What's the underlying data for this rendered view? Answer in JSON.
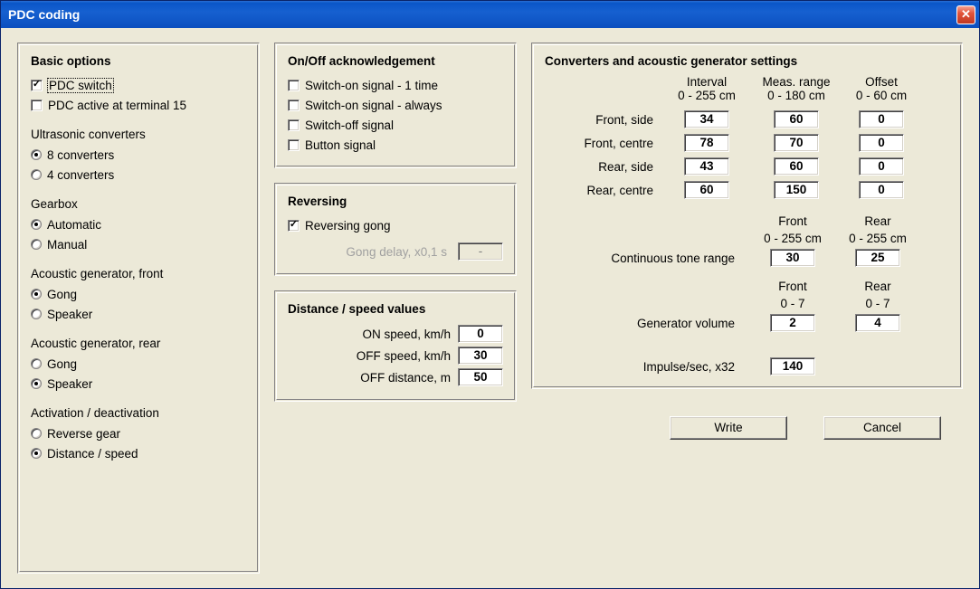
{
  "window": {
    "title": "PDC coding"
  },
  "basic": {
    "title": "Basic options",
    "pdc_switch_label": "PDC switch",
    "pdc_switch": true,
    "pdc_terminal15_label": "PDC active at terminal 15",
    "pdc_terminal15": false,
    "ultrasonic_label": "Ultrasonic converters",
    "ultrasonic_options": {
      "eight": "8 converters",
      "four": "4 converters"
    },
    "ultrasonic_selected": "eight",
    "gearbox_label": "Gearbox",
    "gearbox_options": {
      "auto": "Automatic",
      "manual": "Manual"
    },
    "gearbox_selected": "auto",
    "acoustic_front_label": "Acoustic generator, front",
    "acoustic_options": {
      "gong": "Gong",
      "speaker": "Speaker"
    },
    "acoustic_front_selected": "gong",
    "acoustic_rear_label": "Acoustic generator, rear",
    "acoustic_rear_selected": "speaker",
    "activation_label": "Activation / deactivation",
    "activation_options": {
      "reverse": "Reverse gear",
      "distance": "Distance / speed"
    },
    "activation_selected": "distance"
  },
  "onoff": {
    "title": "On/Off acknowledgement",
    "items": {
      "on1": {
        "label": "Switch-on signal - 1 time",
        "checked": false
      },
      "onalways": {
        "label": "Switch-on signal - always",
        "checked": false
      },
      "off": {
        "label": "Switch-off signal",
        "checked": false
      },
      "button": {
        "label": "Button signal",
        "checked": false
      }
    }
  },
  "reversing": {
    "title": "Reversing",
    "gong_label": "Reversing gong",
    "gong_checked": true,
    "delay_label": "Gong delay, x0,1 s",
    "delay_value": "-"
  },
  "distspeed": {
    "title": "Distance / speed values",
    "on_speed_label": "ON speed, km/h",
    "on_speed": "0",
    "off_speed_label": "OFF speed, km/h",
    "off_speed": "30",
    "off_dist_label": "OFF distance, m",
    "off_dist": "50"
  },
  "conv": {
    "title": "Converters and acoustic generator settings",
    "headers": {
      "interval": "Interval",
      "interval_range": "0 - 255 cm",
      "meas": "Meas. range",
      "meas_range": "0 - 180 cm",
      "offset": "Offset",
      "offset_range": "0 - 60 cm"
    },
    "rows": {
      "fs": {
        "label": "Front, side",
        "interval": "34",
        "meas": "60",
        "offset": "0"
      },
      "fc": {
        "label": "Front, centre",
        "interval": "78",
        "meas": "70",
        "offset": "0"
      },
      "rs": {
        "label": "Rear, side",
        "interval": "43",
        "meas": "60",
        "offset": "0"
      },
      "rc": {
        "label": "Rear, centre",
        "interval": "60",
        "meas": "150",
        "offset": "0"
      }
    },
    "tone": {
      "front_label": "Front",
      "front_range": "0 - 255 cm",
      "rear_label": "Rear",
      "rear_range": "0 - 255 cm",
      "row_label": "Continuous tone range",
      "front": "30",
      "rear": "25"
    },
    "vol": {
      "front_label": "Front",
      "front_range": "0 - 7",
      "rear_label": "Rear",
      "rear_range": "0 - 7",
      "row_label": "Generator volume",
      "front": "2",
      "rear": "4"
    },
    "impulse_label": "Impulse/sec, x32",
    "impulse": "140"
  },
  "buttons": {
    "write": "Write",
    "cancel": "Cancel"
  }
}
